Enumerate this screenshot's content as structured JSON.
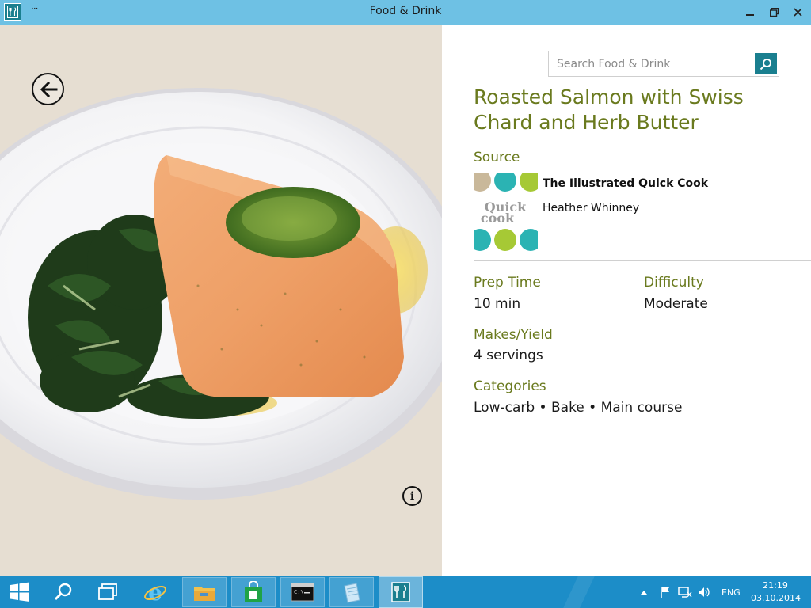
{
  "window": {
    "title": "Food & Drink",
    "menu_glyph": "···"
  },
  "search": {
    "placeholder": "Search Food & Drink"
  },
  "recipe": {
    "title": "Roasted Salmon with Swiss Chard and Herb Butter",
    "source_label": "Source",
    "source_title": "The Illustrated Quick Cook",
    "source_author": "Heather Whinney",
    "cover_text": [
      "Quick",
      "cook"
    ],
    "prep_time_label": "Prep Time",
    "prep_time_value": "10 min",
    "difficulty_label": "Difficulty",
    "difficulty_value": "Moderate",
    "yield_label": "Makes/Yield",
    "yield_value": "4 servings",
    "categories_label": "Categories",
    "categories_value": "Low-carb • Bake • Main course"
  },
  "taskbar": {
    "items": [
      "start-icon",
      "search-icon",
      "task-view-icon",
      "internet-explorer-icon",
      "file-explorer-icon",
      "store-icon",
      "command-prompt-icon",
      "notepad-icon",
      "food-and-drink-icon"
    ],
    "language": "ENG",
    "time": "21:19",
    "date": "03.10.2014"
  },
  "colors": {
    "accent": "#1a7f8f",
    "heading": "#6a7a1e",
    "titlebar": "#6ec1e4",
    "taskbar": "#1c8dc8"
  }
}
